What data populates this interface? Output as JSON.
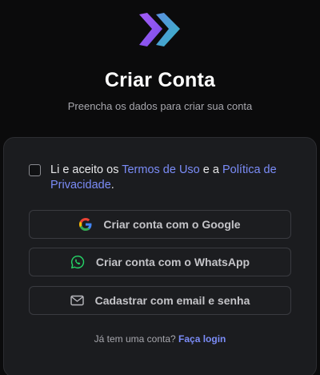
{
  "header": {
    "logo_icon": "double-chevron-right-icon",
    "title": "Criar Conta",
    "subtitle": "Preencha os dados para criar sua conta"
  },
  "terms": {
    "prefix": "Li e aceito os ",
    "terms_link": "Termos de Uso",
    "middle": " e a ",
    "privacy_link": "Política de Privacidade",
    "suffix": ".",
    "checked": false
  },
  "buttons": {
    "google": {
      "label": "Criar conta com o Google",
      "icon": "google-icon"
    },
    "whatsapp": {
      "label": "Criar conta com o WhatsApp",
      "icon": "whatsapp-icon"
    },
    "email": {
      "label": "Cadastrar com email e senha",
      "icon": "mail-icon"
    }
  },
  "footer": {
    "question": "Já tem uma conta? ",
    "login_link": "Faça login"
  },
  "colors": {
    "background": "#0b0b0c",
    "card": "#1b1c1f",
    "accent_link": "#7b8cf7",
    "logo_purple": "#8b5cf6",
    "logo_teal": "#3ea6c8",
    "whatsapp_green": "#25d366"
  }
}
